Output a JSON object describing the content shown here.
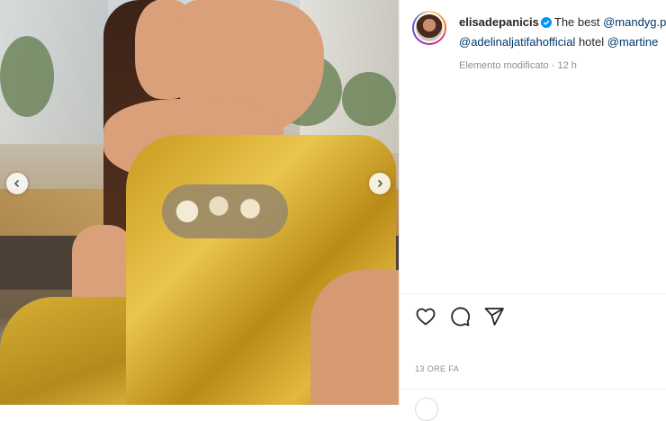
{
  "post": {
    "username": "elisadepanicis",
    "caption_parts": {
      "intro": "The best ",
      "mention1": "@mandyg.p",
      "mention2": "@adelinaljatifahofficial",
      "mid": " hotel ",
      "mention3": "@martine"
    },
    "edited_label": "Elemento modificato",
    "edited_time": "12 h",
    "timestamp": "13 ORE FA"
  },
  "icons": {
    "verified": "verified-badge-icon",
    "like": "heart-icon",
    "comment": "comment-icon",
    "share": "send-icon",
    "prev": "chevron-left-icon",
    "next": "chevron-right-icon"
  },
  "colors": {
    "mention": "#00376b",
    "verified": "#0095f6",
    "meta": "#8e8e8e"
  }
}
